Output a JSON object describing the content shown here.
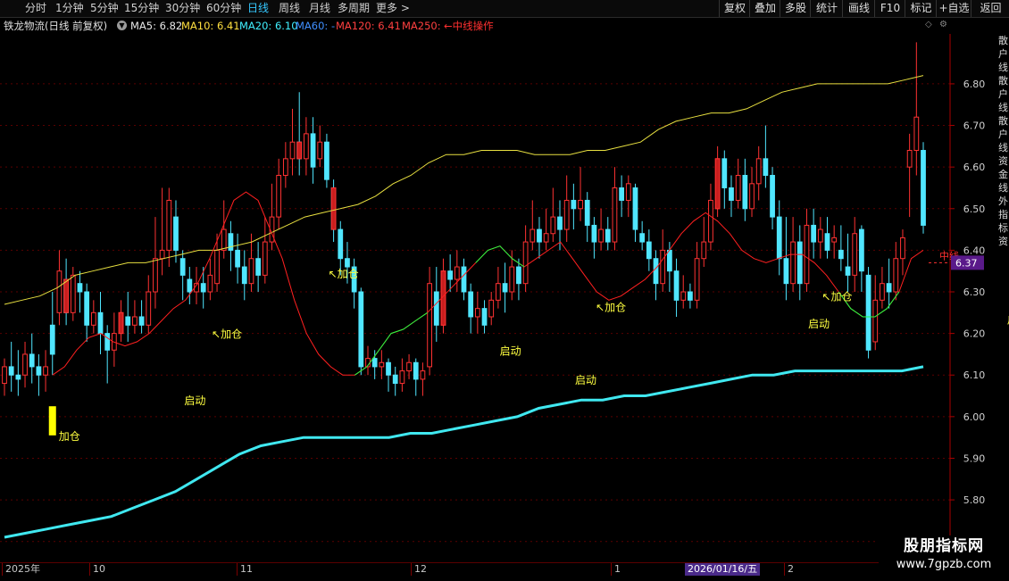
{
  "toolbar": {
    "periods": [
      "分时",
      "1分钟",
      "5分钟",
      "15分钟",
      "30分钟",
      "60分钟",
      "日线",
      "周线",
      "月线",
      "多周期",
      "更多 >"
    ],
    "active": "日线",
    "right_buttons": [
      "复权",
      "叠加",
      "多股",
      "统计",
      "画线",
      "F10",
      "标记",
      "+自选",
      "返回"
    ]
  },
  "info": {
    "title": "铁龙物流(日线 前复权)",
    "ma5": "MA5: 6.82",
    "ma10": "MA10: 6.41",
    "ma20": "MA20: 6.10",
    "ma60": "MA60: -",
    "ma120": "MA120: 6.41",
    "ma250": "MA250: ",
    "note": "←中线操作"
  },
  "colors": {
    "up": "#ff3232",
    "up_fill": "#c81e1e",
    "down": "#50e6ff",
    "yellow_line": "#e8e040",
    "red_line": "#ff2020",
    "green_line": "#20ff40",
    "cyan_line": "#40e8f0",
    "signal_bar": "#ffff00",
    "label": "#ffff40",
    "price_tag_bg": "#5a1a8a"
  },
  "price_tag": "6.37",
  "tag_text": "中线",
  "time_axis": {
    "months": [
      "2025年",
      "10",
      "11",
      "12",
      "1",
      "2"
    ],
    "cursor_date": "2026/01/16/五"
  },
  "right_strip": [
    "散",
    "户",
    "线",
    "散",
    "户",
    "线",
    "散",
    "户",
    "线",
    "资",
    "金",
    "线",
    "外",
    "指",
    "标",
    "资"
  ],
  "watermark": {
    "line1": "股朋指标网",
    "line2": "www.7gpzb.com"
  },
  "chart_data": {
    "type": "candlestick",
    "ylim": [
      5.65,
      6.92
    ],
    "yticks": [
      5.7,
      5.8,
      5.9,
      6.0,
      6.1,
      6.2,
      6.3,
      6.4,
      6.5,
      6.6,
      6.7,
      6.8
    ],
    "ytick_labels": [
      "5.70",
      "5.80",
      "5.90",
      "6.00",
      "6.10",
      "6.20",
      "6.30",
      "6.40",
      "6.50",
      "6.60",
      "6.70",
      "6.80"
    ],
    "candles": [
      [
        6.08,
        6.12,
        6.05,
        6.14
      ],
      [
        6.12,
        6.1,
        6.06,
        6.18
      ],
      [
        6.1,
        6.09,
        6.05,
        6.16
      ],
      [
        6.1,
        6.15,
        6.07,
        6.18
      ],
      [
        6.15,
        6.12,
        6.08,
        6.2
      ],
      [
        6.12,
        6.1,
        6.05,
        6.15
      ],
      [
        6.1,
        6.12,
        6.06,
        6.16
      ],
      [
        6.22,
        6.15,
        6.1,
        6.3
      ],
      [
        6.25,
        6.35,
        6.22,
        6.4
      ],
      [
        6.33,
        6.25,
        6.22,
        6.38
      ],
      [
        6.25,
        6.34,
        6.23,
        6.36
      ],
      [
        6.32,
        6.3,
        6.25,
        6.35
      ],
      [
        6.3,
        6.22,
        6.18,
        6.32
      ],
      [
        6.22,
        6.25,
        6.2,
        6.28
      ],
      [
        6.25,
        6.2,
        6.15,
        6.3
      ],
      [
        6.2,
        6.16,
        6.08,
        6.22
      ],
      [
        6.16,
        6.2,
        6.12,
        6.25
      ],
      [
        6.2,
        6.25,
        6.18,
        6.28
      ],
      [
        6.24,
        6.22,
        6.18,
        6.3
      ],
      [
        6.22,
        6.24,
        6.2,
        6.28
      ],
      [
        6.24,
        6.22,
        6.2,
        6.28
      ],
      [
        6.22,
        6.3,
        6.2,
        6.34
      ],
      [
        6.3,
        6.38,
        6.26,
        6.48
      ],
      [
        6.38,
        6.4,
        6.34,
        6.55
      ],
      [
        6.4,
        6.52,
        6.36,
        6.55
      ],
      [
        6.48,
        6.4,
        6.37,
        6.52
      ],
      [
        6.38,
        6.34,
        6.28,
        6.4
      ],
      [
        6.33,
        6.3,
        6.27,
        6.36
      ],
      [
        6.3,
        6.32,
        6.27,
        6.36
      ],
      [
        6.32,
        6.3,
        6.26,
        6.36
      ],
      [
        6.3,
        6.34,
        6.28,
        6.38
      ],
      [
        6.32,
        6.4,
        6.3,
        6.44
      ],
      [
        6.4,
        6.45,
        6.38,
        6.52
      ],
      [
        6.44,
        6.4,
        6.35,
        6.47
      ],
      [
        6.4,
        6.36,
        6.32,
        6.44
      ],
      [
        6.36,
        6.32,
        6.28,
        6.4
      ],
      [
        6.32,
        6.38,
        6.3,
        6.44
      ],
      [
        6.38,
        6.34,
        6.3,
        6.42
      ],
      [
        6.34,
        6.42,
        6.32,
        6.48
      ],
      [
        6.42,
        6.48,
        6.4,
        6.56
      ],
      [
        6.48,
        6.58,
        6.45,
        6.62
      ],
      [
        6.58,
        6.62,
        6.55,
        6.66
      ],
      [
        6.62,
        6.66,
        6.58,
        6.74
      ],
      [
        6.66,
        6.62,
        6.58,
        6.78
      ],
      [
        6.62,
        6.68,
        6.58,
        6.72
      ],
      [
        6.68,
        6.6,
        6.56,
        6.72
      ],
      [
        6.62,
        6.66,
        6.6,
        6.7
      ],
      [
        6.66,
        6.57,
        6.55,
        6.68
      ],
      [
        6.55,
        6.45,
        6.42,
        6.57
      ],
      [
        6.45,
        6.38,
        6.34,
        6.47
      ],
      [
        6.38,
        6.36,
        6.32,
        6.42
      ],
      [
        6.36,
        6.3,
        6.26,
        6.38
      ],
      [
        6.3,
        6.12,
        6.1,
        6.31
      ],
      [
        6.12,
        6.14,
        6.1,
        6.17
      ],
      [
        6.14,
        6.12,
        6.09,
        6.16
      ],
      [
        6.12,
        6.13,
        6.09,
        6.16
      ],
      [
        6.13,
        6.1,
        6.06,
        6.14
      ],
      [
        6.1,
        6.08,
        6.05,
        6.12
      ],
      [
        6.08,
        6.11,
        6.06,
        6.14
      ],
      [
        6.11,
        6.13,
        6.09,
        6.15
      ],
      [
        6.13,
        6.09,
        6.05,
        6.14
      ],
      [
        6.09,
        6.11,
        6.05,
        6.13
      ],
      [
        6.12,
        6.32,
        6.1,
        6.36
      ],
      [
        6.3,
        6.22,
        6.18,
        6.36
      ],
      [
        6.22,
        6.35,
        6.2,
        6.38
      ],
      [
        6.35,
        6.33,
        6.3,
        6.39
      ],
      [
        6.33,
        6.36,
        6.3,
        6.4
      ],
      [
        6.36,
        6.3,
        6.28,
        6.38
      ],
      [
        6.3,
        6.24,
        6.2,
        6.32
      ],
      [
        6.24,
        6.26,
        6.2,
        6.3
      ],
      [
        6.26,
        6.22,
        6.2,
        6.28
      ],
      [
        6.24,
        6.28,
        6.22,
        6.3
      ],
      [
        6.28,
        6.32,
        6.26,
        6.36
      ],
      [
        6.32,
        6.3,
        6.25,
        6.37
      ],
      [
        6.3,
        6.36,
        6.28,
        6.4
      ],
      [
        6.36,
        6.32,
        6.28,
        6.38
      ],
      [
        6.32,
        6.42,
        6.3,
        6.46
      ],
      [
        6.42,
        6.45,
        6.4,
        6.52
      ],
      [
        6.45,
        6.42,
        6.38,
        6.48
      ],
      [
        6.42,
        6.44,
        6.4,
        6.5
      ],
      [
        6.44,
        6.48,
        6.42,
        6.55
      ],
      [
        6.48,
        6.45,
        6.4,
        6.52
      ],
      [
        6.45,
        6.52,
        6.42,
        6.58
      ],
      [
        6.52,
        6.5,
        6.45,
        6.56
      ],
      [
        6.5,
        6.52,
        6.47,
        6.6
      ],
      [
        6.52,
        6.46,
        6.42,
        6.54
      ],
      [
        6.46,
        6.42,
        6.38,
        6.48
      ],
      [
        6.42,
        6.45,
        6.4,
        6.5
      ],
      [
        6.45,
        6.42,
        6.4,
        6.48
      ],
      [
        6.42,
        6.55,
        6.4,
        6.6
      ],
      [
        6.55,
        6.52,
        6.48,
        6.58
      ],
      [
        6.52,
        6.56,
        6.48,
        6.58
      ],
      [
        6.55,
        6.45,
        6.42,
        6.56
      ],
      [
        6.44,
        6.42,
        6.4,
        6.47
      ],
      [
        6.42,
        6.38,
        6.35,
        6.45
      ],
      [
        6.38,
        6.32,
        6.28,
        6.4
      ],
      [
        6.32,
        6.4,
        6.3,
        6.45
      ],
      [
        6.4,
        6.35,
        6.3,
        6.42
      ],
      [
        6.35,
        6.28,
        6.24,
        6.38
      ],
      [
        6.28,
        6.3,
        6.26,
        6.34
      ],
      [
        6.3,
        6.28,
        6.26,
        6.32
      ],
      [
        6.28,
        6.38,
        6.26,
        6.42
      ],
      [
        6.38,
        6.42,
        6.36,
        6.48
      ],
      [
        6.42,
        6.52,
        6.4,
        6.56
      ],
      [
        6.5,
        6.62,
        6.48,
        6.65
      ],
      [
        6.62,
        6.55,
        6.5,
        6.64
      ],
      [
        6.55,
        6.52,
        6.48,
        6.58
      ],
      [
        6.52,
        6.58,
        6.5,
        6.62
      ],
      [
        6.58,
        6.5,
        6.47,
        6.62
      ],
      [
        6.5,
        6.56,
        6.48,
        6.6
      ],
      [
        6.56,
        6.62,
        6.52,
        6.65
      ],
      [
        6.62,
        6.58,
        6.55,
        6.7
      ],
      [
        6.58,
        6.48,
        6.45,
        6.6
      ],
      [
        6.48,
        6.38,
        6.34,
        6.52
      ],
      [
        6.38,
        6.32,
        6.28,
        6.48
      ],
      [
        6.32,
        6.42,
        6.3,
        6.48
      ],
      [
        6.42,
        6.32,
        6.28,
        6.46
      ],
      [
        6.32,
        6.46,
        6.3,
        6.5
      ],
      [
        6.46,
        6.42,
        6.38,
        6.5
      ],
      [
        6.42,
        6.45,
        6.38,
        6.48
      ],
      [
        6.44,
        6.4,
        6.38,
        6.48
      ],
      [
        6.42,
        6.43,
        6.38,
        6.46
      ],
      [
        6.4,
        6.38,
        6.35,
        6.46
      ],
      [
        6.36,
        6.34,
        6.3,
        6.44
      ],
      [
        6.34,
        6.44,
        6.3,
        6.48
      ],
      [
        6.45,
        6.35,
        6.3,
        6.46
      ],
      [
        6.34,
        6.16,
        6.14,
        6.36
      ],
      [
        6.18,
        6.28,
        6.16,
        6.34
      ],
      [
        6.28,
        6.32,
        6.26,
        6.36
      ],
      [
        6.32,
        6.3,
        6.26,
        6.38
      ],
      [
        6.3,
        6.38,
        6.28,
        6.42
      ],
      [
        6.38,
        6.43,
        6.34,
        6.45
      ],
      [
        6.6,
        6.64,
        6.48,
        6.68
      ],
      [
        6.64,
        6.72,
        6.58,
        6.9
      ],
      [
        6.64,
        6.46,
        6.44,
        6.66
      ]
    ],
    "ma_yellow": [
      6.27,
      6.28,
      6.29,
      6.31,
      6.34,
      6.35,
      6.36,
      6.37,
      6.37,
      6.38,
      6.39,
      6.4,
      6.4,
      6.41,
      6.42,
      6.44,
      6.46,
      6.48,
      6.49,
      6.5,
      6.51,
      6.53,
      6.56,
      6.58,
      6.61,
      6.63,
      6.63,
      6.64,
      6.64,
      6.64,
      6.63,
      6.63,
      6.63,
      6.64,
      6.64,
      6.65,
      6.66,
      6.69,
      6.71,
      6.72,
      6.73,
      6.73,
      6.74,
      6.76,
      6.78,
      6.79,
      6.8,
      6.8,
      6.8,
      6.8,
      6.8,
      6.81,
      6.82
    ],
    "ma_red_signal": [
      6.1,
      6.12,
      6.16,
      6.19,
      6.2,
      6.18,
      6.17,
      6.18,
      6.2,
      6.23,
      6.26,
      6.28,
      6.32,
      6.38,
      6.45,
      6.52,
      6.54,
      6.52,
      6.45,
      6.38,
      6.28,
      6.2,
      6.15,
      6.12,
      6.1,
      6.1,
      6.12,
      6.16,
      6.2,
      6.21,
      6.23,
      6.25,
      6.28,
      6.31,
      6.34,
      6.37,
      6.4,
      6.41,
      6.38,
      6.36,
      6.38,
      6.4,
      6.42,
      6.38,
      6.34,
      6.3,
      6.28,
      6.29,
      6.31,
      6.33,
      6.36,
      6.4,
      6.44,
      6.47,
      6.49,
      6.47,
      6.44,
      6.4,
      6.38,
      6.37,
      6.38,
      6.39,
      6.39,
      6.37,
      6.34,
      6.3,
      6.26,
      6.24,
      6.24,
      6.26,
      6.3,
      6.38,
      6.4
    ],
    "ma_cyan": [
      5.71,
      5.72,
      5.73,
      5.74,
      5.75,
      5.76,
      5.78,
      5.8,
      5.82,
      5.85,
      5.88,
      5.91,
      5.93,
      5.94,
      5.95,
      5.95,
      5.95,
      5.95,
      5.95,
      5.96,
      5.96,
      5.97,
      5.98,
      5.99,
      6.0,
      6.02,
      6.03,
      6.04,
      6.04,
      6.05,
      6.05,
      6.06,
      6.07,
      6.08,
      6.09,
      6.1,
      6.1,
      6.11,
      6.11,
      6.11,
      6.11,
      6.11,
      6.11,
      6.12
    ],
    "signals": [
      {
        "text": "加仓",
        "candle": 7,
        "price": 5.955,
        "bar": true
      },
      {
        "text": "启动",
        "candle": 27,
        "price": 6.04
      },
      {
        "text": "↖加仓",
        "candle": 31,
        "price": 6.2
      },
      {
        "text": "↖加仓",
        "candle": 48,
        "price": 6.345
      },
      {
        "text": "启动",
        "candle": 73,
        "price": 6.16
      },
      {
        "text": "启动",
        "candle": 84,
        "price": 6.09
      },
      {
        "text": "↖加仓",
        "candle": 87,
        "price": 6.265
      },
      {
        "text": "启动",
        "candle": 118,
        "price": 6.225
      },
      {
        "text": "↖加仓",
        "candle": 120,
        "price": 6.29
      },
      {
        "text": "启动",
        "candle": 147,
        "price": 6.235
      },
      {
        "text": "↖加仓",
        "candle": 149,
        "price": 6.395
      }
    ]
  }
}
